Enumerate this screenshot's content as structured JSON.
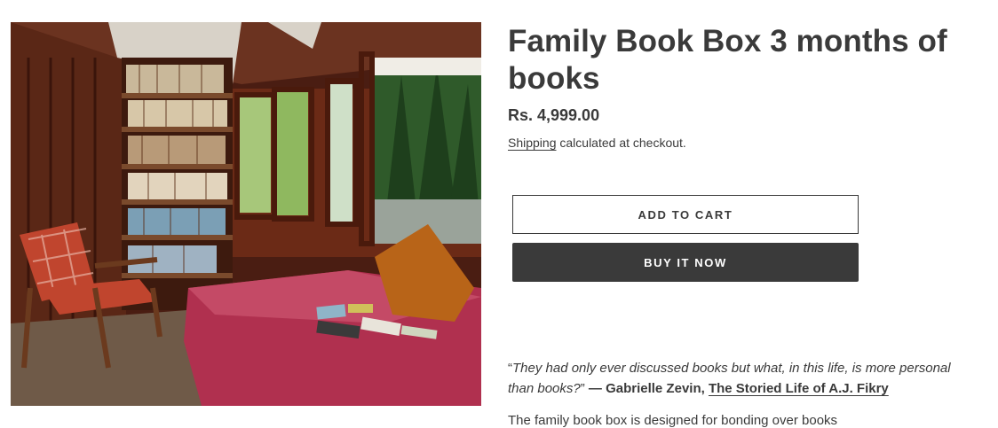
{
  "product": {
    "title": "Family Book Box 3 months of books",
    "price": "Rs. 4,999.00",
    "shipping_link": "Shipping",
    "shipping_text": " calculated at checkout.",
    "image_label": "Reading room with bookshelf, armchair and daybed"
  },
  "actions": {
    "add_to_cart": "Add to cart",
    "buy_now": "Buy it now"
  },
  "quote": {
    "open_mark": "“",
    "text": "They had only ever discussed books but what, in this life, is more personal than books?",
    "close_mark": "”",
    "attribution": " — Gabrielle Zevin, ",
    "book_title": "The Storied Life of A.J. Fikry"
  },
  "description": {
    "text": "The family book box is designed for bonding over books"
  },
  "colors": {
    "text": "#3a3a3a",
    "button_dark": "#3a3a3a",
    "background": "#ffffff"
  }
}
